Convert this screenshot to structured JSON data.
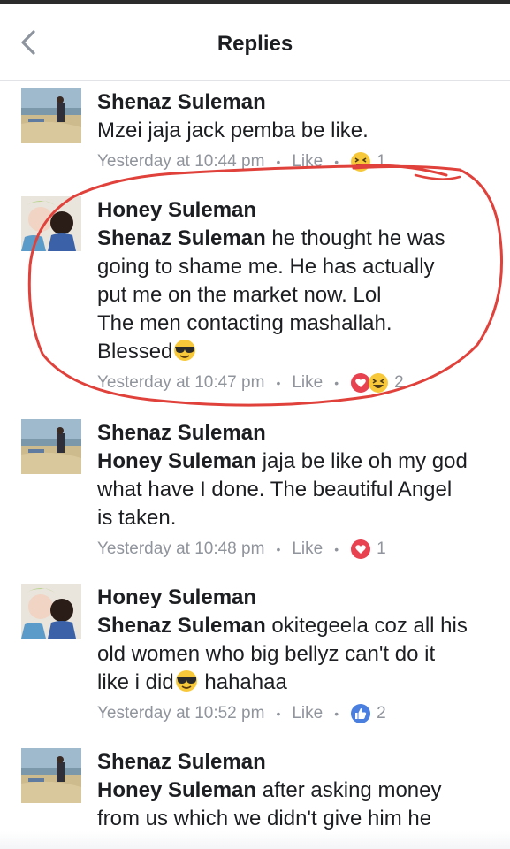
{
  "header": {
    "title": "Replies"
  },
  "replies": [
    {
      "author": "Shenaz Suleman",
      "tag": "",
      "text": "Mzei jaja jack pemba be like.",
      "time": "Yesterday at 10:44 pm",
      "like_label": "Like",
      "reactions": [
        "haha"
      ],
      "count": "1"
    },
    {
      "author": "Honey Suleman",
      "tag": "Shenaz Suleman",
      "text_lines": [
        " he thought he was",
        "going to shame me. He has actually",
        "put me on the  market now. Lol",
        "The men contacting mashallah.",
        "Blessed"
      ],
      "time": "Yesterday at 10:47 pm",
      "like_label": "Like",
      "reactions": [
        "love",
        "haha"
      ],
      "count": "2"
    },
    {
      "author": "Shenaz Suleman",
      "tag": "Honey Suleman",
      "text_lines": [
        " jaja be like oh my god",
        "what have I done. The beautiful Angel",
        "is taken."
      ],
      "time": "Yesterday at 10:48 pm",
      "like_label": "Like",
      "reactions": [
        "love"
      ],
      "count": "1"
    },
    {
      "author": "Honey Suleman",
      "tag": "Shenaz Suleman",
      "text_lines": [
        " okitegeela coz all his",
        "old women who big bellyz can't do it",
        "like i did",
        " hahahaa"
      ],
      "time": "Yesterday at 10:52 pm",
      "like_label": "Like",
      "reactions": [
        "like"
      ],
      "count": "2"
    },
    {
      "author": "Shenaz Suleman",
      "tag": "Honey Suleman",
      "text_lines": [
        " after asking money",
        "from us which we didn't give him he"
      ]
    }
  ],
  "colors": {
    "annotation": "#e0413b",
    "meta": "#90949c",
    "like_blue": "#4a7fe0",
    "love_red": "#e8414f",
    "haha_yellow": "#f7c93a"
  }
}
